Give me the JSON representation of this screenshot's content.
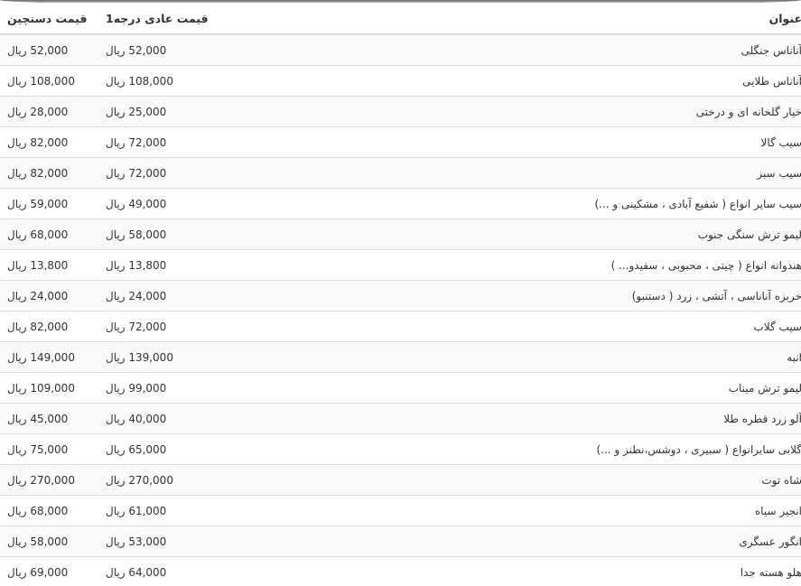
{
  "table": {
    "headers": {
      "title": "عنوان",
      "regular_price": "قیمت عادی درجه1",
      "secondhand_price": "قیمت دستچین"
    },
    "rows": [
      {
        "title": "آناناس جنگلی",
        "regular_price": "52,000 ریال",
        "secondhand_price": "52,000 ریال"
      },
      {
        "title": "آناناس طلایی",
        "regular_price": "108,000 ریال",
        "secondhand_price": "108,000 ریال"
      },
      {
        "title": "خیار گلخانه ای و درختی",
        "regular_price": "25,000 ریال",
        "secondhand_price": "28,000 ریال"
      },
      {
        "title": "سیب گالا",
        "regular_price": "72,000 ریال",
        "secondhand_price": "82,000 ریال"
      },
      {
        "title": "سیب سبز",
        "regular_price": "72,000 ریال",
        "secondhand_price": "82,000 ریال"
      },
      {
        "title": "سیب سایر انواع ( شفیع آبادی ، مشکینی و ...)",
        "regular_price": "49,000 ریال",
        "secondhand_price": "59,000 ریال"
      },
      {
        "title": "لیمو ترش سنگی جنوب",
        "regular_price": "58,000 ریال",
        "secondhand_price": "68,000 ریال"
      },
      {
        "title": "هندوانه انواع ( چیتی ، محبوبی ، سفیدو... )",
        "regular_price": "13,800 ریال",
        "secondhand_price": "13,800 ریال"
      },
      {
        "title": "خربزه آناناسی ، آتشی ، زرد ( دستنبو)",
        "regular_price": "24,000 ریال",
        "secondhand_price": "24,000 ریال"
      },
      {
        "title": "سیب گلاب",
        "regular_price": "72,000 ریال",
        "secondhand_price": "82,000 ریال"
      },
      {
        "title": "انبه",
        "regular_price": "139,000 ریال",
        "secondhand_price": "149,000 ریال"
      },
      {
        "title": "لیمو ترش میناب",
        "regular_price": "99,000 ریال",
        "secondhand_price": "109,000 ریال"
      },
      {
        "title": "آلو زرد قطره طلا",
        "regular_price": "40,000 ریال",
        "secondhand_price": "45,000 ریال"
      },
      {
        "title": "گلابی سایرانواع ( سبیری ، دوشس،نطنز و ...)",
        "regular_price": "65,000 ریال",
        "secondhand_price": "75,000 ریال"
      },
      {
        "title": "شاه توت",
        "regular_price": "270,000 ریال",
        "secondhand_price": "270,000 ریال"
      },
      {
        "title": "انجیر سیاه",
        "regular_price": "61,000 ریال",
        "secondhand_price": "68,000 ریال"
      },
      {
        "title": "انگور عسگری",
        "regular_price": "53,000 ریال",
        "secondhand_price": "58,000 ریال"
      },
      {
        "title": "هلو هسته جدا",
        "regular_price": "64,000 ریال",
        "secondhand_price": "69,000 ریال"
      }
    ]
  }
}
